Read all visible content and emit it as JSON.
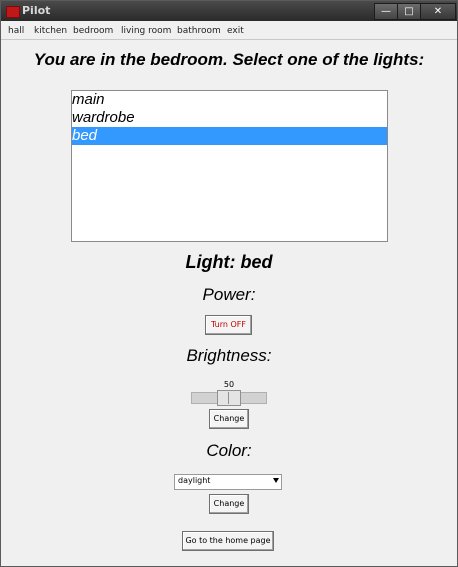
{
  "window": {
    "title": "Pilot",
    "minimize_icon": "minimize-icon",
    "maximize_icon": "maximize-icon",
    "close_icon": "close-icon"
  },
  "menu": {
    "items": [
      "hall",
      "kitchen",
      "bedroom",
      "living room",
      "bathroom",
      "exit"
    ]
  },
  "main": {
    "heading": "You are in the bedroom. Select one of the lights:",
    "lights": [
      "main",
      "wardrobe",
      "bed"
    ],
    "selected_light": "bed",
    "light_title": "Light: bed",
    "power_label": "Power:",
    "power_button": "Turn OFF",
    "brightness_label": "Brightness:",
    "brightness_value": "50",
    "brightness_change_button": "Change",
    "color_label": "Color:",
    "color_selected": "daylight",
    "color_change_button": "Change",
    "home_button": "Go to the home page"
  },
  "colors": {
    "selection": "#3399ff",
    "power_text": "#c00000",
    "app_icon": "#c01818"
  }
}
